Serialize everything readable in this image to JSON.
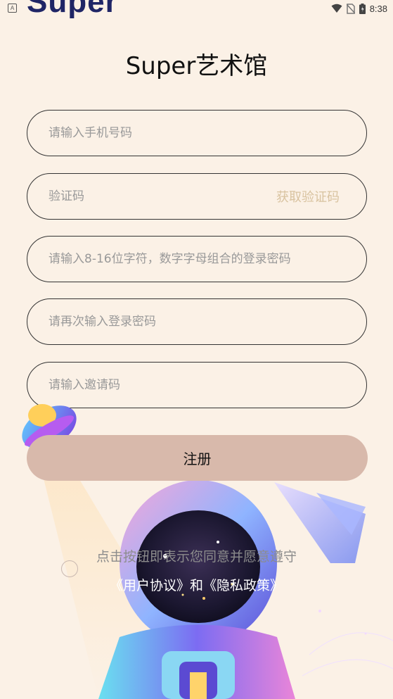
{
  "status_bar": {
    "logo_fragment": "Super",
    "time": "8:38",
    "indicator_a": "A"
  },
  "header": {
    "title": "Super艺术馆"
  },
  "form": {
    "phone_placeholder": "请输入手机号码",
    "code_placeholder": "验证码",
    "get_code_label": "获取验证码",
    "password_placeholder": "请输入8-16位字符，数字字母组合的登录密码",
    "confirm_password_placeholder": "请再次输入登录密码",
    "invite_placeholder": "请输入邀请码",
    "register_label": "注册"
  },
  "agreement": {
    "line1": "点击按钮即表示您同意并愿意遵守",
    "user_agreement": "《用户协议》",
    "and": "和",
    "privacy_policy": "《隐私政策》"
  },
  "colors": {
    "background": "#fbf1e6",
    "button": "#d8b9ab",
    "get_code": "#d9c3a0",
    "logo": "#1f2566"
  }
}
